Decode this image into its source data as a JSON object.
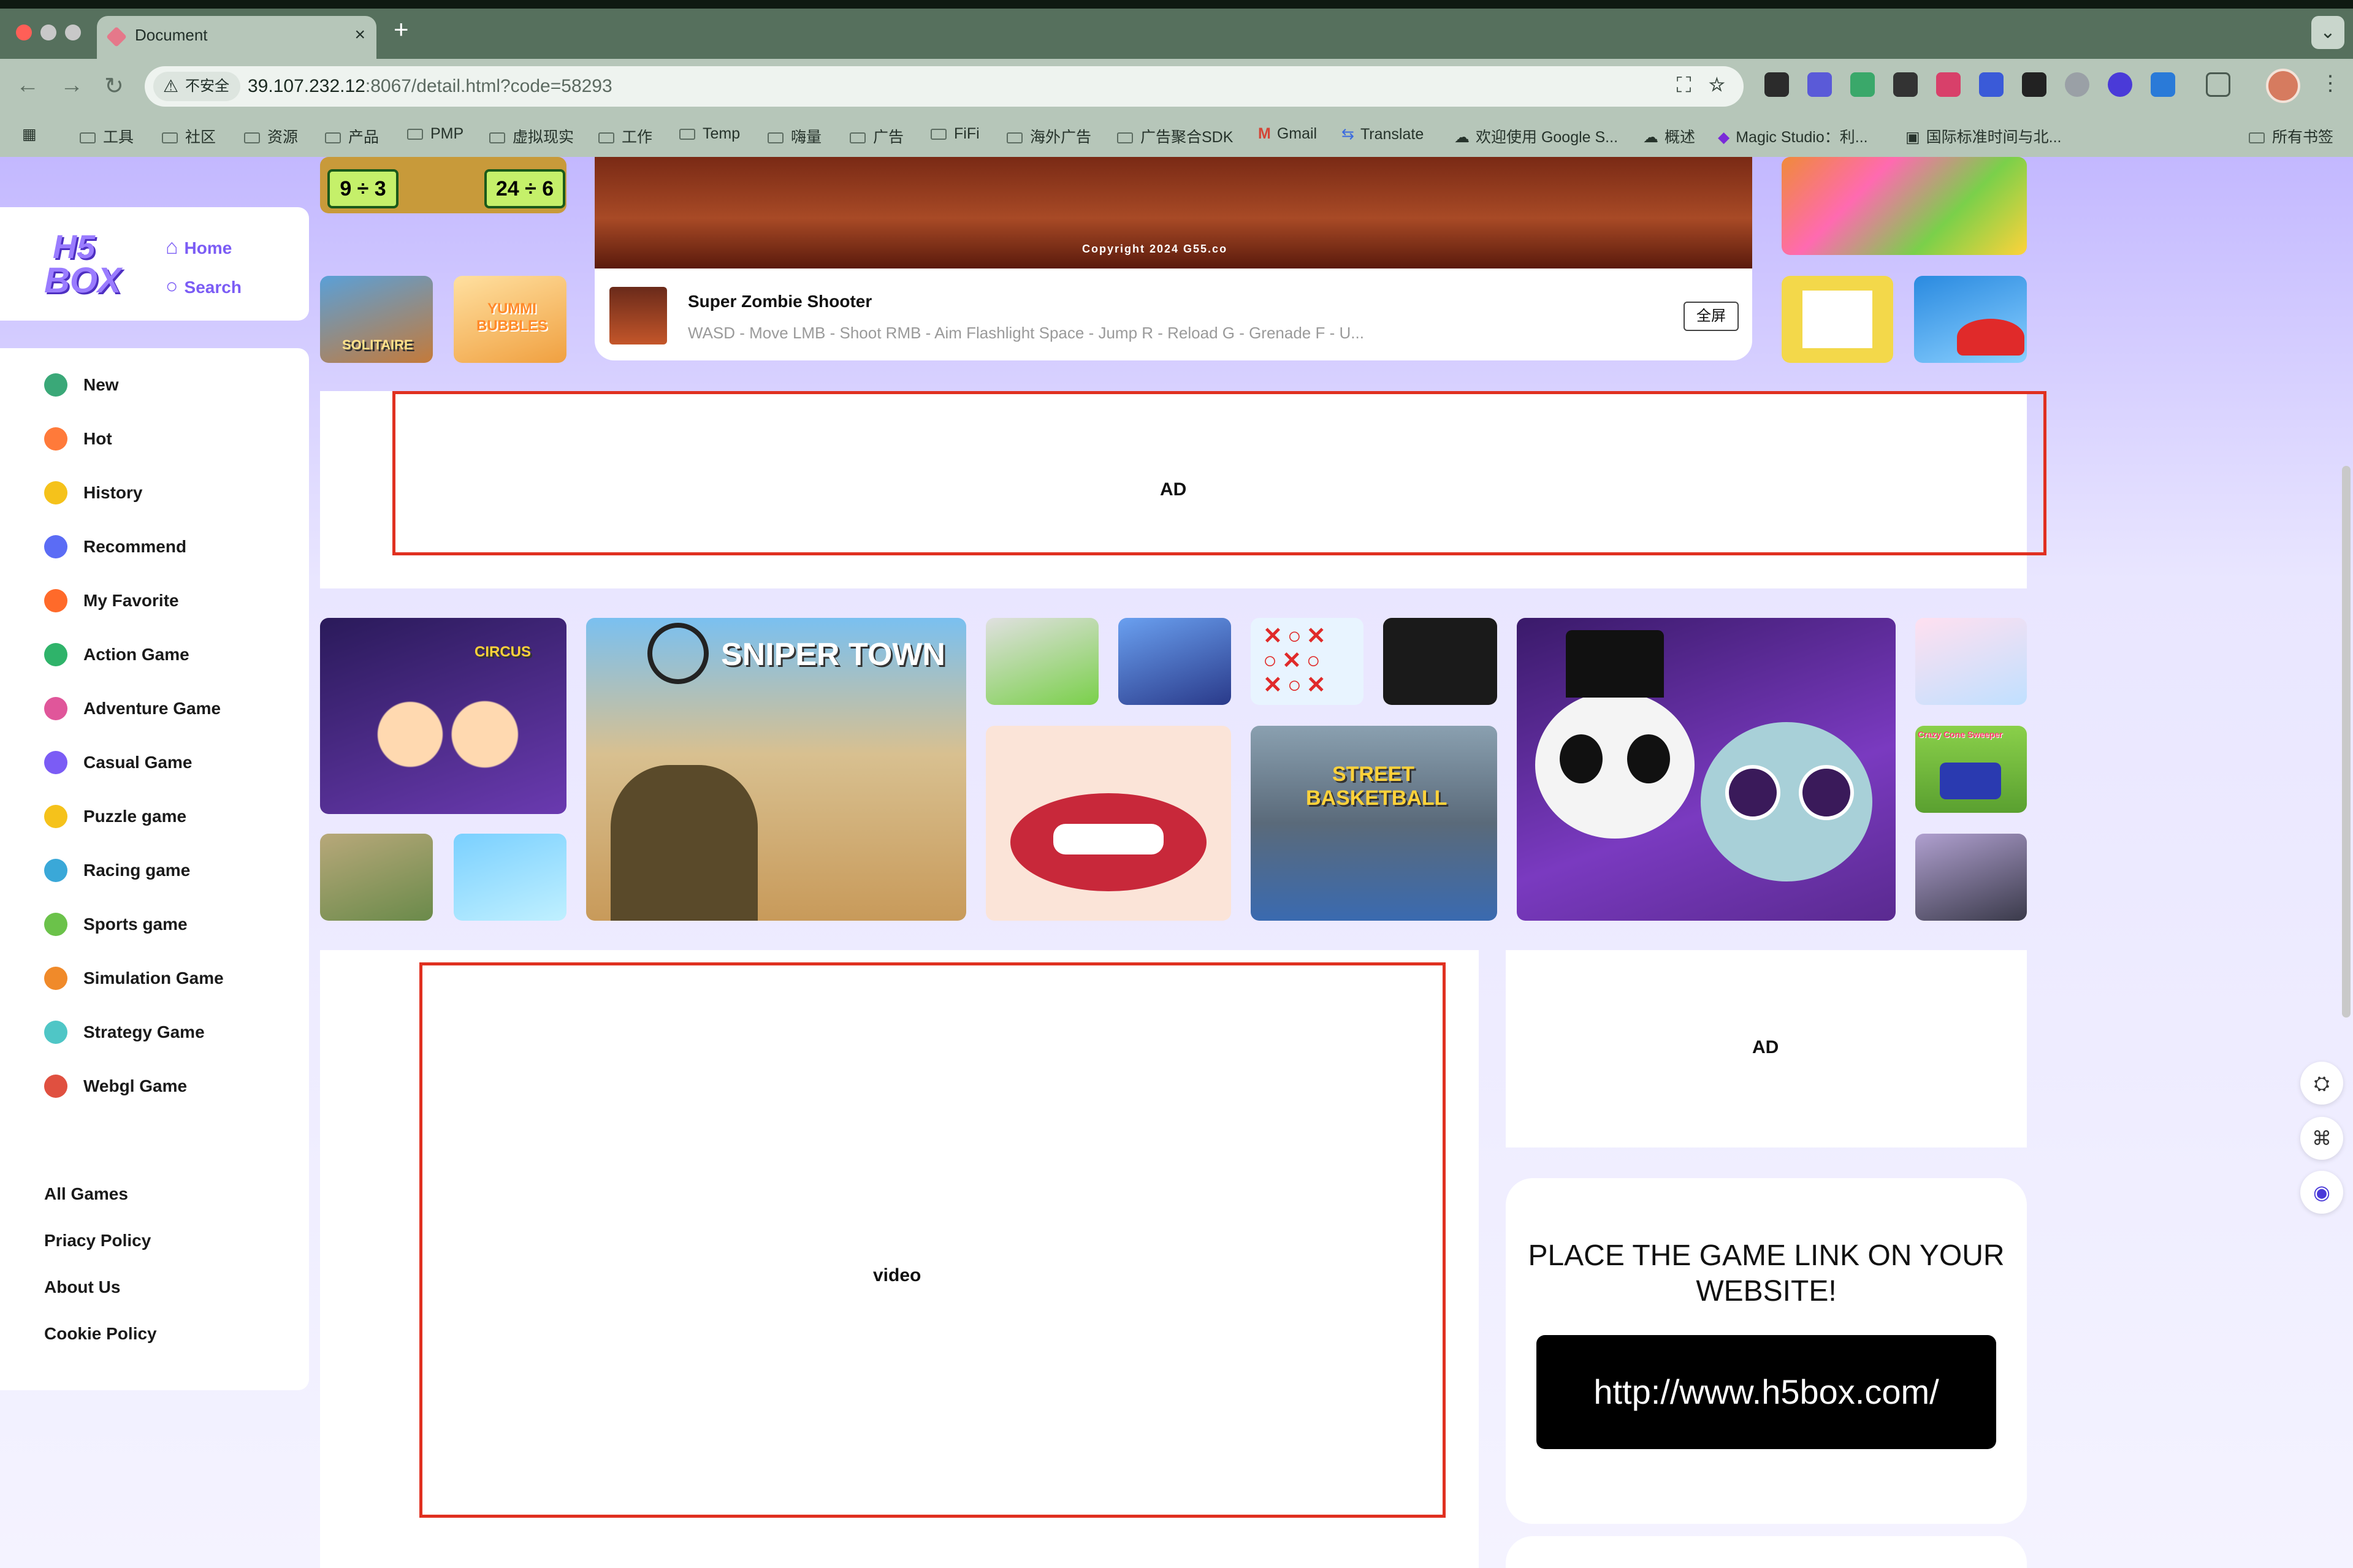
{
  "browser": {
    "tab_title": "Document",
    "tab_close": "×",
    "new_tab": "+",
    "security_label": "不安全",
    "url_host": "39.107.232.12",
    "url_path": ":8067/detail.html?code=58293",
    "bookmarks": [
      "工具",
      "社区",
      "资源",
      "产品",
      "PMP",
      "虚拟现实",
      "工作",
      "Temp",
      "嗨量",
      "广告",
      "FiFi",
      "海外广告",
      "广告聚合SDK",
      "Gmail",
      "Translate",
      "欢迎使用 Google S...",
      "概述",
      "Magic Studio：利...",
      "国际标准时间与北...",
      "所有书签"
    ]
  },
  "logo": {
    "line1": "H5",
    "line2": "BOX"
  },
  "nav": {
    "home": "Home",
    "search": "Search"
  },
  "sidebar": {
    "items": [
      {
        "label": "New",
        "color": "#3aa878"
      },
      {
        "label": "Hot",
        "color": "#ff7a3a"
      },
      {
        "label": "History",
        "color": "#f5c21b"
      },
      {
        "label": "Recommend",
        "color": "#5b6cf5"
      },
      {
        "label": "My Favorite",
        "color": "#ff6a2a"
      },
      {
        "label": "Action Game",
        "color": "#2fb36a"
      },
      {
        "label": "Adventure Game",
        "color": "#e0569a"
      },
      {
        "label": "Casual Game",
        "color": "#7b5cf5"
      },
      {
        "label": "Puzzle game",
        "color": "#f5c21b"
      },
      {
        "label": "Racing game",
        "color": "#3aa8d8"
      },
      {
        "label": "Sports game",
        "color": "#6bc24a"
      },
      {
        "label": "Simulation Game",
        "color": "#f08a2a"
      },
      {
        "label": "Strategy Game",
        "color": "#4fc6c6"
      },
      {
        "label": "Webgl Game",
        "color": "#e05040"
      }
    ],
    "footer": [
      "All Games",
      "Priacy Policy",
      "About Us",
      "Cookie Policy"
    ]
  },
  "player": {
    "copyright": "Copyright 2024 G55.co",
    "title": "Super Zombie Shooter",
    "description": "WASD - Move LMB - Shoot RMB - Aim Flashlight Space - Jump R - Reload G - Grenade F - U...",
    "fullscreen": "全屏"
  },
  "top_thumbs": {
    "math1": "9 ÷ 3",
    "math2": "24 ÷ 6",
    "bubbles": "YUMMI BUBBLES",
    "solitaire": "SOLITAIRE"
  },
  "games": {
    "sniper": "SNIPER TOWN",
    "circus": "CIRCUS",
    "basketball": "STREET BASKETBALL",
    "crazy_cone": "Crazy Cone Sweeper"
  },
  "ad_label": "AD",
  "video_label": "video",
  "share": {
    "title": "PLACE THE GAME LINK ON YOUR WEBSITE!",
    "link": "http://www.h5box.com/"
  }
}
